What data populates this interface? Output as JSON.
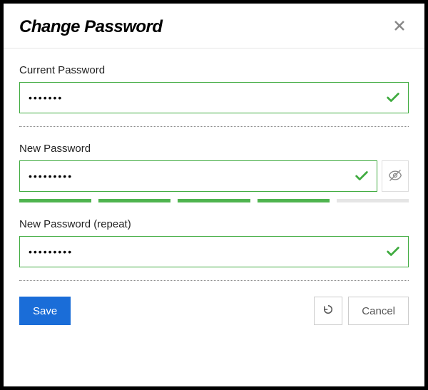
{
  "dialog": {
    "title": "Change Password"
  },
  "fields": {
    "current": {
      "label": "Current Password",
      "value": "•••••••",
      "valid": true
    },
    "new": {
      "label": "New Password",
      "value": "•••••••••",
      "valid": true,
      "strength_segments": 5,
      "strength_filled": 4
    },
    "repeat": {
      "label": "New Password (repeat)",
      "value": "•••••••••",
      "valid": true
    }
  },
  "buttons": {
    "save": "Save",
    "cancel": "Cancel"
  },
  "colors": {
    "valid_border": "#3fab3f",
    "primary": "#1a6dd8"
  }
}
